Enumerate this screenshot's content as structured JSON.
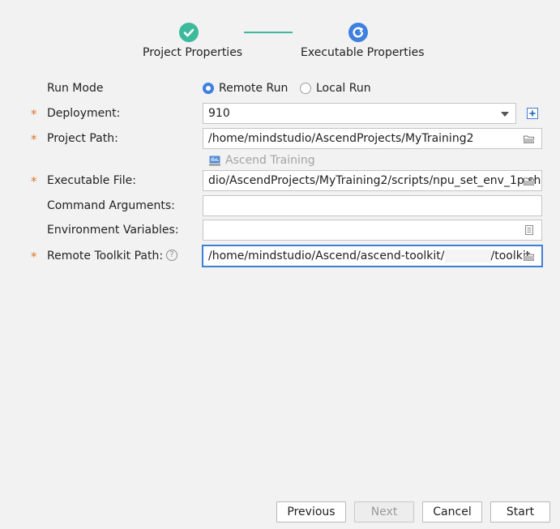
{
  "stepper": {
    "step1": "Project Properties",
    "step2": "Executable Properties",
    "line_color": "#3dba9c",
    "done_color": "#3dba9c",
    "active_color": "#3f7fe0"
  },
  "run_mode": {
    "label": "Run Mode",
    "options": [
      "Remote Run",
      "Local Run"
    ],
    "selected": "Remote Run"
  },
  "deployment": {
    "label": "Deployment:",
    "value": "910"
  },
  "project_path": {
    "label": "Project Path:",
    "value": "/home/mindstudio/AscendProjects/MyTraining2"
  },
  "project_type": {
    "label": "Ascend Training"
  },
  "executable_file": {
    "label": "Executable File:",
    "value": "dio/AscendProjects/MyTraining2/scripts/npu_set_env_1p.sh"
  },
  "command_arguments": {
    "label": "Command Arguments:",
    "value": ""
  },
  "environment_variables": {
    "label": "Environment Variables:",
    "value": ""
  },
  "remote_toolkit_path": {
    "label": "Remote Toolkit Path:",
    "value_prefix": "/home/mindstudio/Ascend/ascend-toolkit/",
    "value_suffix": "/toolkit",
    "help_icon": "?"
  },
  "required_mark": "*",
  "buttons": {
    "previous": "Previous",
    "next": "Next",
    "cancel": "Cancel",
    "start": "Start"
  },
  "colors": {
    "accent": "#3f7fd3",
    "required": "#e0762a",
    "background": "#f2f2f2"
  }
}
